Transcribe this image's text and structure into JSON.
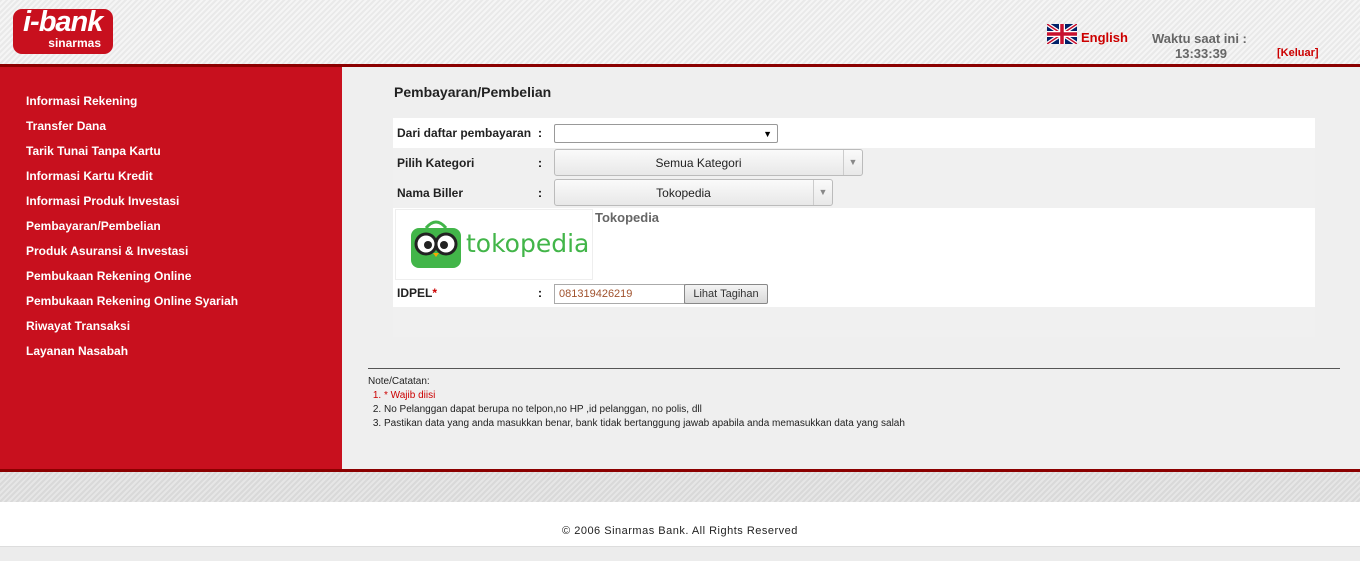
{
  "header": {
    "logo_main": "i-bank",
    "logo_sub": "sinarmas",
    "language_label": "English",
    "time_label": "Waktu saat ini :",
    "time_value": "13:33:39",
    "logout_label": "[Keluar]"
  },
  "sidebar": {
    "items": [
      {
        "label": "Informasi Rekening"
      },
      {
        "label": "Transfer Dana"
      },
      {
        "label": "Tarik Tunai Tanpa Kartu"
      },
      {
        "label": "Informasi Kartu Kredit"
      },
      {
        "label": "Informasi Produk Investasi"
      },
      {
        "label": "Pembayaran/Pembelian"
      },
      {
        "label": "Produk Asuransi & Investasi"
      },
      {
        "label": "Pembukaan Rekening Online"
      },
      {
        "label": "Pembukaan Rekening Online Syariah"
      },
      {
        "label": "Riwayat Transaksi"
      },
      {
        "label": "Layanan Nasabah"
      }
    ]
  },
  "main": {
    "title": "Pembayaran/Pembelian",
    "colon": ":",
    "required_mark": "*",
    "from_list": {
      "label": "Dari daftar pembayaran",
      "value": ""
    },
    "category": {
      "label": "Pilih Kategori",
      "value": "Semua Kategori"
    },
    "biller": {
      "label": "Nama Biller",
      "value": "Tokopedia"
    },
    "biller_logo_text": "tokopedia",
    "biller_name": "Tokopedia",
    "idpel": {
      "label": "IDPEL",
      "value": "081319426219"
    },
    "lihat_button": "Lihat Tagihan",
    "notes_title": "Note/Catatan:",
    "notes": [
      "* Wajib diisi",
      "No Pelanggan dapat berupa no telpon,no HP ,id pelanggan, no polis, dll",
      "Pastikan data yang anda masukkan benar, bank tidak bertanggung jawab apabila anda memasukkan data yang salah"
    ]
  },
  "footer": {
    "copyright": "© 2006 Sinarmas Bank. All Rights Reserved"
  },
  "colors": {
    "brand_red": "#c8101e",
    "dark_red_line": "#8b0000",
    "tokopedia_green": "#42b549"
  }
}
